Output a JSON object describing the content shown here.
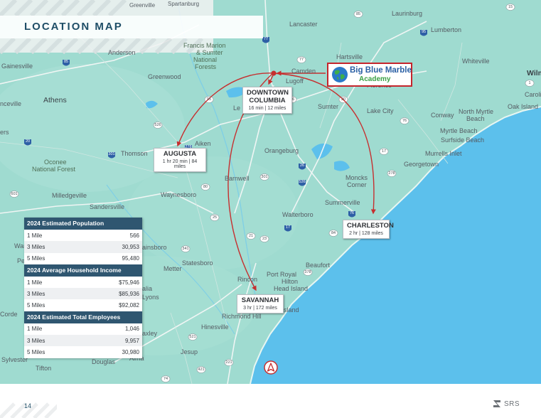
{
  "header": {
    "title": "LOCATION MAP"
  },
  "logo": {
    "line1": "Big Blue Marble",
    "line2": "Academy"
  },
  "cities": [
    {
      "name_lines": [
        "DOWNTOWN",
        "COLUMBIA"
      ],
      "distance": "16 min | 12 miles"
    },
    {
      "name_lines": [
        "AUGUSTA"
      ],
      "distance": "1 hr 20 min | 84 miles"
    },
    {
      "name_lines": [
        "CHARLESTON"
      ],
      "distance": "2 hr | 128 miles"
    },
    {
      "name_lines": [
        "SAVANNAH"
      ],
      "distance": "3 hr | 172 miles"
    }
  ],
  "stats": {
    "population": {
      "title": "2024 Estimated Population",
      "rows": [
        {
          "label": "1 Mile",
          "value": "566"
        },
        {
          "label": "3 Miles",
          "value": "30,953"
        },
        {
          "label": "5 Miles",
          "value": "95,480"
        }
      ]
    },
    "income": {
      "title": "2024 Average Household Income",
      "rows": [
        {
          "label": "1 Mile",
          "value": "$75,946"
        },
        {
          "label": "3 Miles",
          "value": "$85,936"
        },
        {
          "label": "5 Miles",
          "value": "$92,082"
        }
      ]
    },
    "employees": {
      "title": "2024 Estimated Total Employees",
      "rows": [
        {
          "label": "1 Mile",
          "value": "1,046"
        },
        {
          "label": "3 Miles",
          "value": "9,957"
        },
        {
          "label": "5 Miles",
          "value": "30,980"
        }
      ]
    }
  },
  "map_labels": {
    "greenville": "Greenville",
    "spartanburg": "Spartanburg",
    "laurinburg": "Laurinburg",
    "lancaster": "Lancaster",
    "lumberton": "Lumberton",
    "anderson": "Anderson",
    "francis_marion": "Francis Marion",
    "sumter_nf": "& Sumter",
    "national": "National",
    "forests": "Forests",
    "hartsville": "Hartsville",
    "gainesville": "Gainesville",
    "whiteville": "Whiteville",
    "greenwood": "Greenwood",
    "camden": "Camden",
    "lugoff": "Lugoff",
    "florence": "Florence",
    "wilmington": "Wilm",
    "athens": "Athens",
    "nceville": "nceville",
    "lexington": "Le",
    "sumter": "Sumter",
    "lake_city": "Lake City",
    "conway": "Conway",
    "north_myrtle": "North Myrtle",
    "beach": "Beach",
    "oak_island": "Oak Island",
    "caroli": "Caroli",
    "myrtle_beach": "Myrtle Beach",
    "surfside_beach": "Surfside Beach",
    "aiken": "Aiken",
    "ers": "ers",
    "thomson": "Thomson",
    "orangeburg": "Orangeburg",
    "murrells_inlet": "Murrells Inlet",
    "oconee": "Oconee",
    "national_forest": "National Forest",
    "georgetown": "Georgetown",
    "barnwell": "Barnwell",
    "moncks": "Moncks",
    "corner": "Corner",
    "milledgeville": "Milledgeville",
    "waynesboro": "Waynesboro",
    "sandersville": "Sandersville",
    "summerville": "Summerville",
    "walterboro": "Walterboro",
    "statesboro": "Statesboro",
    "ainsboro": "ainsboro",
    "metter": "Metter",
    "beaufort": "Beaufort",
    "rincon": "Rincon",
    "port_royal": "Port Royal",
    "hilton": "Hilton",
    "head_island": "Head Island",
    "lyons": "Lyons",
    "alia": "alia",
    "richmond_hill": "Richmond Hill",
    "sland": "sland",
    "hinesville": "Hinesville",
    "axley": "axley",
    "jesup": "Jesup",
    "douglas": "Douglas",
    "alma": "Alma",
    "sylvester": "Sylvester",
    "tifton": "Tifton",
    "corde": "Corde",
    "war": "War",
    "pe": "Pe"
  },
  "route_numbers": [
    "85",
    "77",
    "20",
    "95",
    "26",
    "76",
    "526",
    "17",
    "301",
    "278",
    "601",
    "25",
    "21",
    "23",
    "84",
    "341",
    "378",
    "521",
    "221",
    "421",
    "74",
    "15",
    "1",
    "80"
  ],
  "footer": {
    "page_number": "14",
    "brand": "SRS"
  },
  "colors": {
    "land": "#9fdbd0",
    "ocean": "#5cc0ec",
    "route_arrow": "#c62f2f",
    "title": "#1f4e67",
    "stats_header": "#2f5670",
    "logo_border": "#c4252c"
  },
  "icons": {
    "north_arrow": "north-arrow-icon",
    "globe": "globe-icon",
    "brand": "srs-logo-icon"
  }
}
